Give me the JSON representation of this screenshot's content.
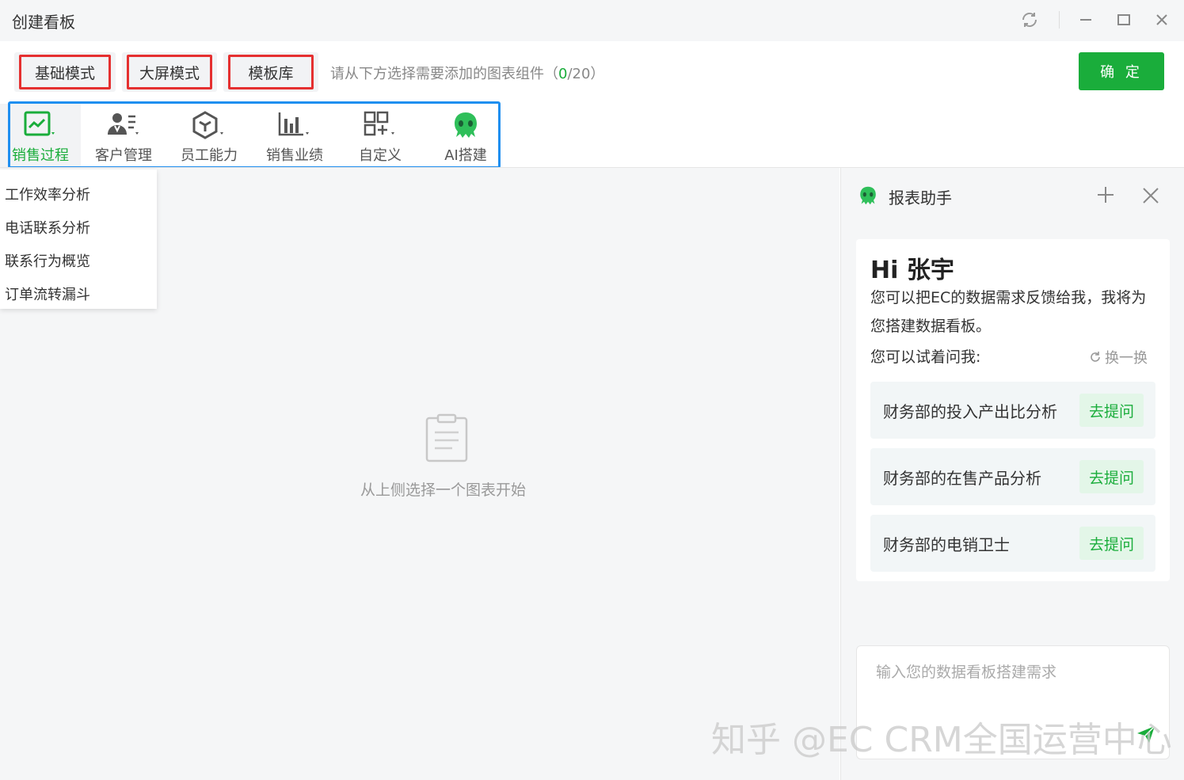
{
  "window": {
    "title": "创建看板"
  },
  "toolbar": {
    "modes": [
      "基础模式",
      "大屏模式",
      "模板库"
    ],
    "hint_prefix": "请从下方选择需要添加的图表组件（",
    "hint_count": "0",
    "hint_suffix": "/20）",
    "confirm_label": "确 定"
  },
  "categories": [
    {
      "label": "销售过程",
      "icon": "line-chart-icon",
      "active": true
    },
    {
      "label": "客户管理",
      "icon": "customer-icon"
    },
    {
      "label": "员工能力",
      "icon": "cube-icon"
    },
    {
      "label": "销售业绩",
      "icon": "bar-chart-icon"
    },
    {
      "label": "自定义",
      "icon": "grid-plus-icon"
    },
    {
      "label": "AI搭建",
      "icon": "ai-mascot-icon"
    }
  ],
  "dropdown": {
    "items": [
      "工作效率分析",
      "电话联系分析",
      "联系行为概览",
      "订单流转漏斗"
    ]
  },
  "canvas": {
    "empty_text": "从上侧选择一个图表开始"
  },
  "assistant": {
    "title": "报表助手",
    "greeting": "Hi 张宇",
    "intro": "您可以把EC的数据需求反馈给我，我将为您搭建数据看板。",
    "try_label": "您可以试着问我:",
    "refresh_label": "换一换",
    "questions": [
      {
        "text": "财务部的投入产出比分析",
        "button": "去提问"
      },
      {
        "text": "财务部的在售产品分析",
        "button": "去提问"
      },
      {
        "text": "财务部的电销卫士",
        "button": "去提问"
      }
    ],
    "input_placeholder": "输入您的数据看板搭建需求"
  },
  "watermark": "知乎 @EC CRM全国运营中心",
  "colors": {
    "accent_green": "#1aad3b",
    "highlight_red": "#e53030",
    "highlight_blue": "#1f8ff0"
  }
}
